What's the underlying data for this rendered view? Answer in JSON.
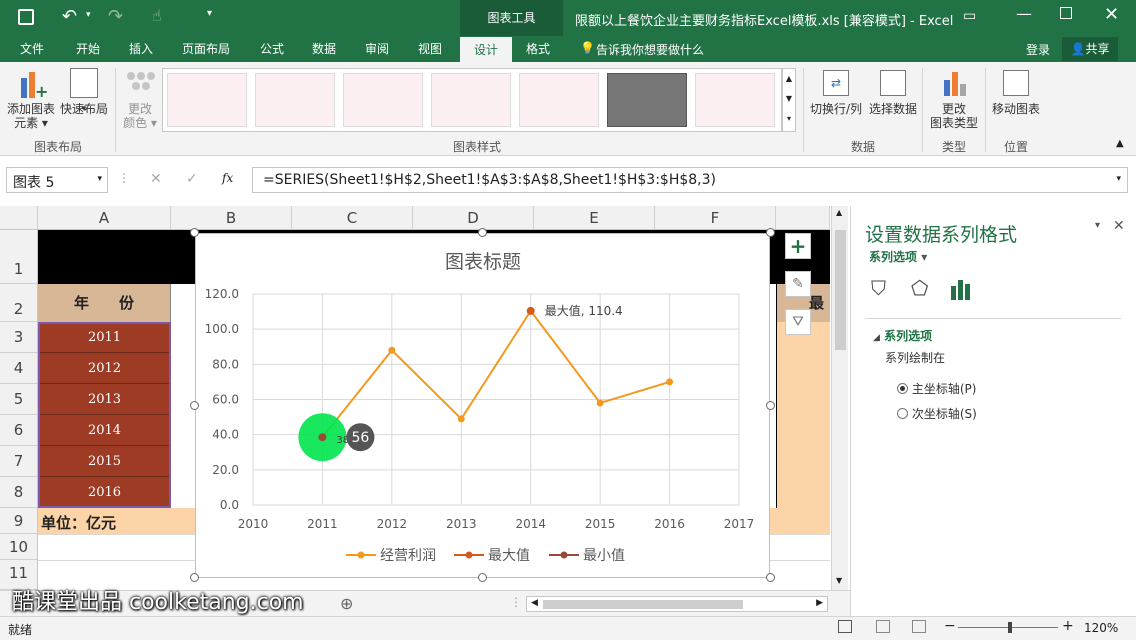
{
  "titlebar": {
    "chart_tools": "图表工具",
    "doc_title": "限额以上餐饮企业主要财务指标Excel模板.xls  [兼容模式] - Excel"
  },
  "tabs": [
    "文件",
    "开始",
    "插入",
    "页面布局",
    "公式",
    "数据",
    "审阅",
    "视图",
    "设计",
    "格式"
  ],
  "tell_me": "告诉我你想要做什么",
  "login": "登录",
  "share": "共享",
  "ribbon": {
    "add_element": "添加图表",
    "add_element2": "元素",
    "quick_layout": "快速布局",
    "change_color": "更改",
    "change_color2": "颜色",
    "group_layout": "图表布局",
    "group_styles": "图表样式",
    "switch_rowcol": "切换行/列",
    "select_data": "选择数据",
    "group_data": "数据",
    "change_type": "更改",
    "change_type2": "图表类型",
    "group_type": "类型",
    "move_chart": "移动图表",
    "group_location": "位置"
  },
  "formula": {
    "name_box": "图表 5",
    "fx": "fx",
    "text": "=SERIES(Sheet1!$H$2,Sheet1!$A$3:$A$8,Sheet1!$H$3:$H$8,3)"
  },
  "sheet": {
    "columns": [
      "A",
      "B",
      "C",
      "D",
      "E",
      "F"
    ],
    "rows": [
      "1",
      "2",
      "3",
      "4",
      "5",
      "6",
      "7",
      "8",
      "9",
      "10",
      "11"
    ],
    "year_header": "年　　份",
    "years": [
      "2011",
      "2012",
      "2013",
      "2014",
      "2015",
      "2016"
    ],
    "unit": "单位：亿元",
    "right_header": "最",
    "tab_add": "⊕"
  },
  "chart_data": {
    "type": "line",
    "title": "图表标题",
    "x": [
      "2010",
      "2011",
      "2012",
      "2013",
      "2014",
      "2015",
      "2016",
      "2017"
    ],
    "y_ticks": [
      "0.0",
      "20.0",
      "40.0",
      "60.0",
      "80.0",
      "100.0",
      "120.0"
    ],
    "ylim": [
      0,
      120
    ],
    "series": [
      {
        "name": "经营利润",
        "color": "#f39a1e",
        "points": [
          [
            2011,
            38.56
          ],
          [
            2012,
            88
          ],
          [
            2013,
            49
          ],
          [
            2014,
            110.4
          ],
          [
            2015,
            58
          ],
          [
            2016,
            70
          ]
        ]
      },
      {
        "name": "最大值",
        "color": "#d35b1e",
        "points": [
          [
            2014,
            110.4
          ]
        ]
      },
      {
        "name": "最小值",
        "color": "#9b4a3a",
        "points": [
          [
            2011,
            38.56
          ]
        ]
      }
    ],
    "max_label": "最大值, 110.4",
    "min_label": "56",
    "min_label_small": "38.5"
  },
  "pane": {
    "title": "设置数据系列格式",
    "subtitle": "系列选项",
    "section": "系列选项",
    "plot_on": "系列绘制在",
    "primary": "主坐标轴(P)",
    "secondary": "次坐标轴(S)"
  },
  "status": {
    "ready": "就绪",
    "zoom": "120%"
  },
  "watermark": "酷课堂出品 coolketang.com"
}
